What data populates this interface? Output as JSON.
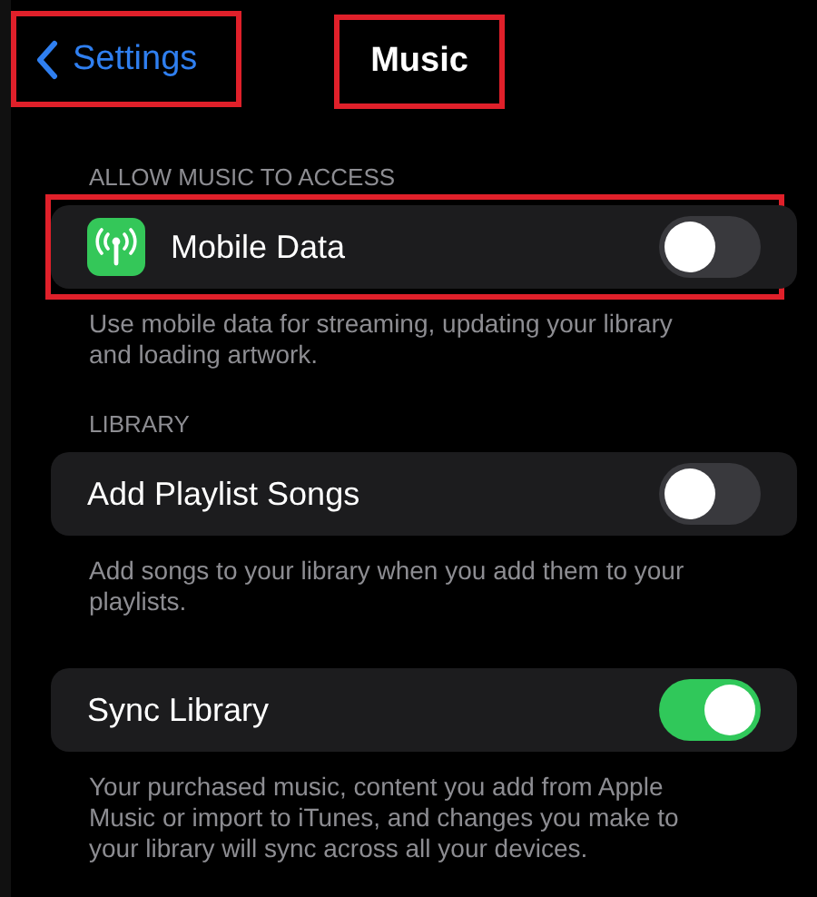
{
  "nav": {
    "back": {
      "label": "Settings",
      "highlighted": true
    },
    "title": {
      "text": "Music",
      "highlighted": true
    }
  },
  "sections": [
    {
      "header": "ALLOW MUSIC TO ACCESS",
      "rows": [
        {
          "kind": "icon_toggle",
          "label": "Mobile Data",
          "on": false,
          "highlighted": true
        }
      ],
      "footer": "Use mobile data for streaming, updating your library and loading artwork."
    },
    {
      "header": "LIBRARY",
      "rows": [
        {
          "kind": "toggle",
          "label": "Add Playlist Songs",
          "on": false,
          "highlighted": false
        }
      ],
      "footer": "Add songs to your library when you add them to your playlists."
    },
    {
      "rows": [
        {
          "kind": "toggle",
          "label": "Sync Library",
          "on": true,
          "highlighted": false
        }
      ],
      "footer": "Your purchased music, content you add from Apple Music or import to iTunes, and changes you make to your library will sync across all your devices."
    }
  ]
}
